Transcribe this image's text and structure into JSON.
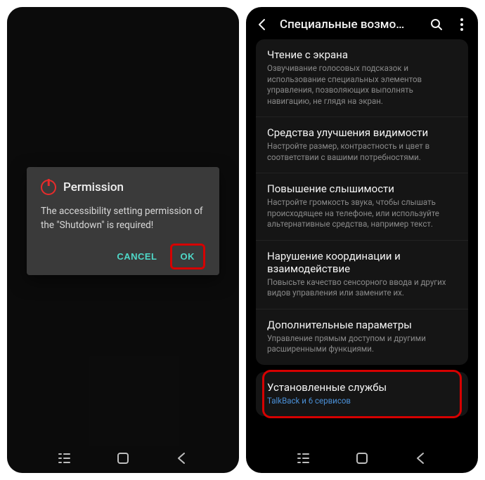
{
  "dialog": {
    "title": "Permission",
    "body": "The accessibility setting permission of the \"Shutdown\" is required!",
    "cancel": "CANCEL",
    "ok": "OK"
  },
  "settings": {
    "header_title": "Специальные возмо…",
    "rows": [
      {
        "title": "Чтение с экрана",
        "sub": "Озвучивание голосовых подсказок и использование специальных элементов управления, позволяющих выполнять навигацию, не глядя на экран."
      },
      {
        "title": "Средства улучшения видимости",
        "sub": "Настройте размер, контрастность и цвет в соответствии с вашими потребностями."
      },
      {
        "title": "Повышение слышимости",
        "sub": "Настройте громкость звука, чтобы слышать происходящее на телефоне, или используйте альтернативные средства, например текст."
      },
      {
        "title": "Нарушение координации и взаимодействие",
        "sub": "Повысьте качество сенсорного ввода и других видов управления или замените их."
      },
      {
        "title": "Дополнительные параметры",
        "sub": "Управление прямым доступом и другими расширенными функциями."
      }
    ],
    "installed": {
      "title": "Установленные службы",
      "sub": "TalkBack и 6 сервисов"
    }
  },
  "nav": {
    "recents": "recents",
    "home": "home",
    "back": "back"
  },
  "colors": {
    "accent_teal": "#4fd8c8",
    "accent_red": "#d60000",
    "link_blue": "#4a8fd6"
  }
}
